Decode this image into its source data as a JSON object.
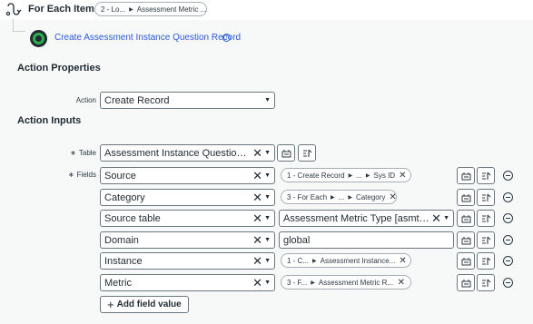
{
  "header": {
    "title": "For Each Item in",
    "pill": {
      "part1": "2 - Lo...",
      "part2": "Assessment Metric ..."
    }
  },
  "step": {
    "link_label": "Create Assessment Instance Question Record",
    "help": "?"
  },
  "action_properties": {
    "title": "Action Properties",
    "action_label": "Action",
    "action_value": "Create Record"
  },
  "action_inputs": {
    "title": "Action Inputs",
    "table_label": "Table",
    "table_value": "Assessment Instance Question [...",
    "fields_label": "Fields",
    "rows": [
      {
        "field": "Source",
        "pill": {
          "parts": [
            "1 - Create Record",
            "...",
            "Sys ID"
          ]
        }
      },
      {
        "field": "Category",
        "pill": {
          "parts": [
            "3 - For Each",
            "...",
            "Category"
          ]
        }
      },
      {
        "field": "Source table",
        "value_select": "Assessment Metric Type [asmt_..."
      },
      {
        "field": "Domain",
        "value_text": "global"
      },
      {
        "field": "Instance",
        "pill": {
          "parts": [
            "1 - C...",
            "Assessment Instance..."
          ]
        }
      },
      {
        "field": "Metric",
        "pill": {
          "parts": [
            "3 - F...",
            "Assessment Metric R..."
          ]
        }
      }
    ],
    "add_label": "Add field value"
  },
  "symbols": {
    "required": "∗",
    "clear": "✕",
    "caret": "▼",
    "sep": "▶",
    "plus": "+"
  },
  "icons": [
    "flow-loop-icon",
    "action-step-icon",
    "help-icon",
    "clear-icon",
    "dropdown-caret-icon",
    "data-pill-picker-icon",
    "script-toggle-icon",
    "remove-row-icon",
    "plus-icon"
  ],
  "colors": {
    "link": "#2a5bd7",
    "step_green": "#2bb24c",
    "border": "#6b777f",
    "background": "#f7f8f8"
  }
}
